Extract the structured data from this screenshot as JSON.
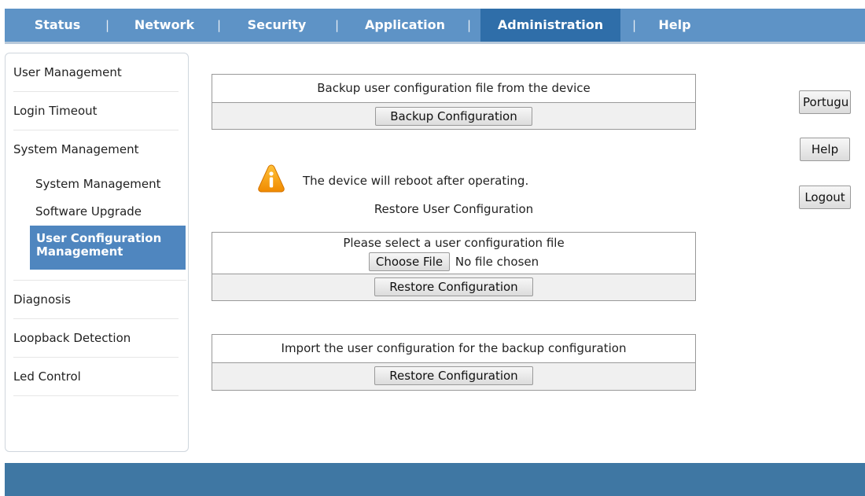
{
  "nav": {
    "items": [
      "Status",
      "Network",
      "Security",
      "Application",
      "Administration",
      "Help"
    ],
    "separator": "|",
    "active": "Administration"
  },
  "sidebar": {
    "user_management": "User Management",
    "login_timeout": "Login Timeout",
    "system_management": "System Management",
    "sub_system_management": "System Management",
    "sub_software_upgrade": "Software Upgrade",
    "sub_user_config": "User Configuration Management",
    "diagnosis": "Diagnosis",
    "loopback_detection": "Loopback Detection",
    "led_control": "Led Control"
  },
  "backup": {
    "title": "Backup user configuration file from the device",
    "button": "Backup Configuration"
  },
  "warning": {
    "text": "The device will reboot after operating.",
    "section_title": "Restore User Configuration"
  },
  "restore": {
    "prompt": "Please select a user configuration file",
    "choose_button": "Choose File",
    "no_file": "No file chosen",
    "button": "Restore Configuration"
  },
  "import": {
    "title": "Import the user configuration for the backup configuration",
    "button": "Restore Configuration"
  },
  "right": {
    "language": "Portugu",
    "help": "Help",
    "logout": "Logout"
  },
  "colors": {
    "nav_bg": "#5e93c6",
    "nav_active": "#2f6ea9",
    "sidebar_active": "#4f86bf",
    "footer": "#3f77a3"
  }
}
